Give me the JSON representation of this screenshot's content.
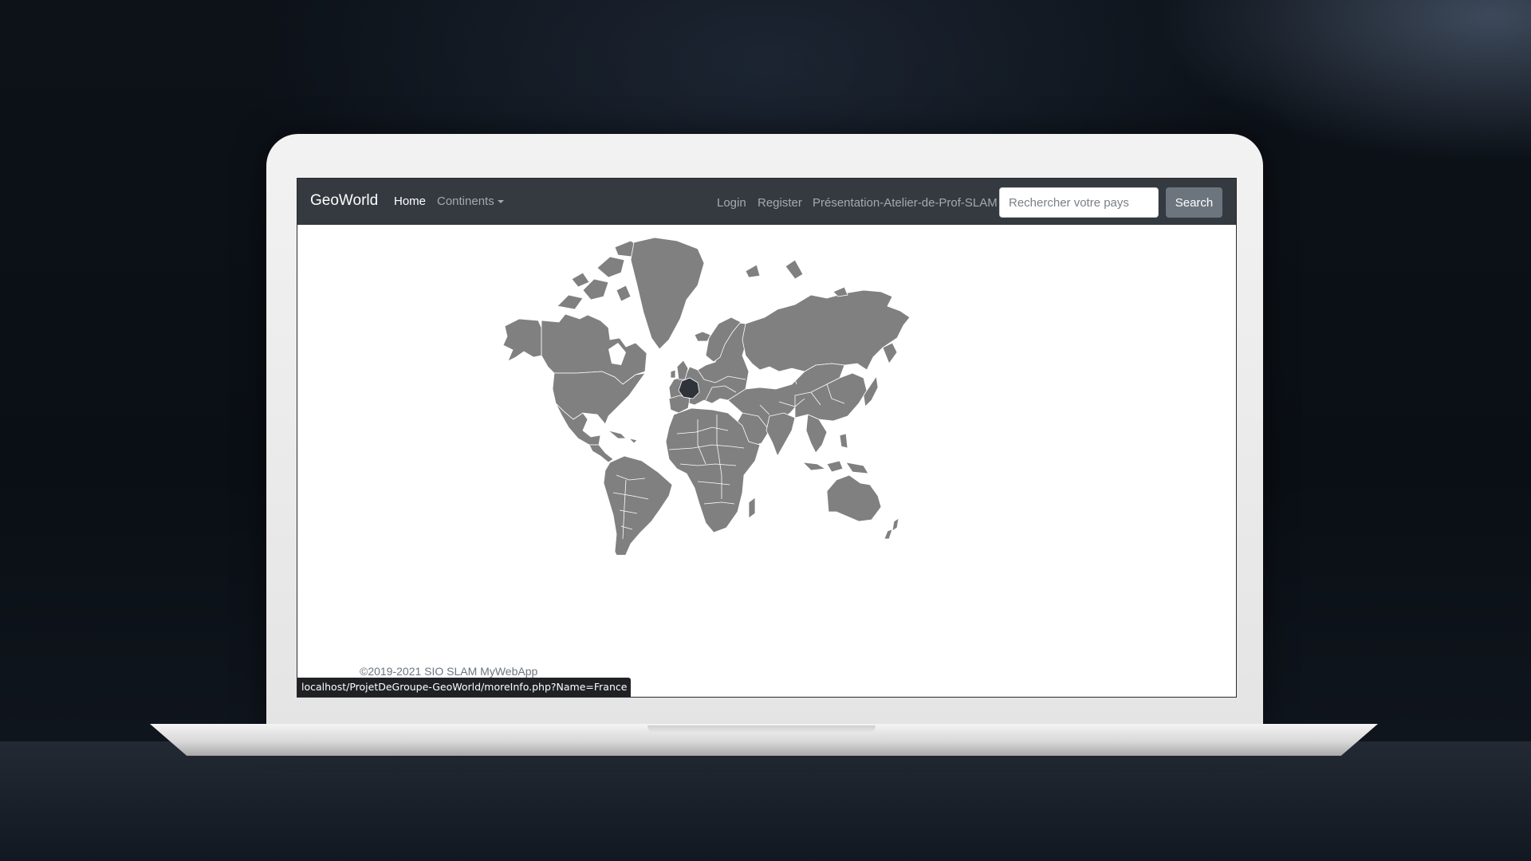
{
  "navbar": {
    "brand": "GeoWorld",
    "home": "Home",
    "continents": "Continents",
    "login": "Login",
    "register": "Register",
    "presentation": "Présentation-Atelier-de-Prof-SLAM",
    "search_placeholder": "Rechercher votre pays",
    "search_button": "Search"
  },
  "map": {
    "land_color": "#808080",
    "highlight_color": "#2f333a"
  },
  "footer": {
    "copyright": "©2019-2021 SIO SLAM MyWebApp"
  },
  "status_bar": {
    "url": "localhost/ProjetDeGroupe-GeoWorld/moreInfo.php?Name=France"
  }
}
